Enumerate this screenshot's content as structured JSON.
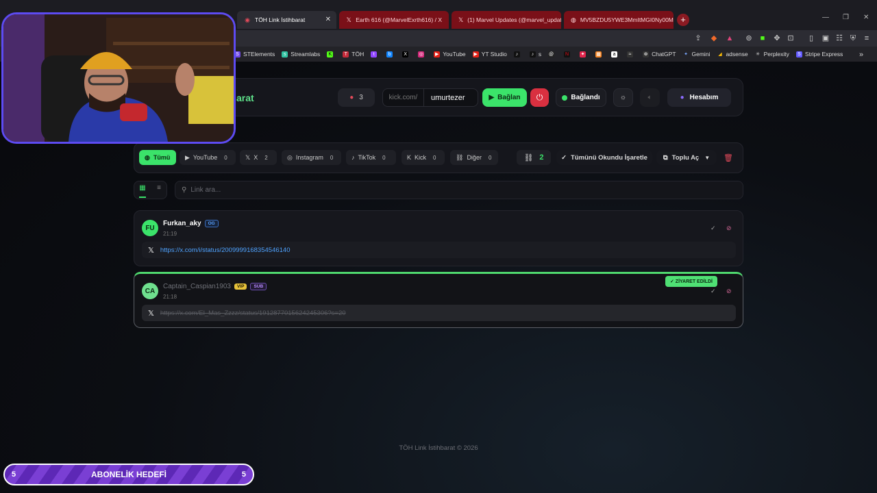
{
  "browser": {
    "tabs": [
      {
        "title": "TÖH Link İstihbarat",
        "active": true
      },
      {
        "title": "Earth 616 (@MarvelExrth616) / X",
        "active": false
      },
      {
        "title": "(1) Marvel Updates (@marvel_updat",
        "active": false
      },
      {
        "title": "MV5BZDU5YWE3MmItMGI0Ny00MY",
        "active": false
      }
    ],
    "bookmarks": [
      "STElements",
      "Streamlabs",
      "TÖH",
      "YouTube",
      "YT Studio",
      "s",
      "ChatGPT",
      "Gemini",
      "adsense",
      "Perplexity",
      "Stripe Express"
    ]
  },
  "app": {
    "brand": "arat",
    "live_count": "3",
    "url_prefix": "kick.com/",
    "channel": "umurtezer",
    "connect_label": "Bağlan",
    "status_label": "Bağlandı",
    "account_label": "Hesabım"
  },
  "filters": [
    {
      "label": "Tümü",
      "count": "",
      "active": true
    },
    {
      "label": "YouTube",
      "count": "0"
    },
    {
      "label": "X",
      "count": "2"
    },
    {
      "label": "Instagram",
      "count": "0"
    },
    {
      "label": "TikTok",
      "count": "0"
    },
    {
      "label": "Kick",
      "count": "0"
    },
    {
      "label": "Diğer",
      "count": "0"
    }
  ],
  "toolbar": {
    "link_total": "2",
    "mark_all": "Tümünü Okundu İşaretle",
    "bulk_open": "Toplu Aç"
  },
  "search": {
    "placeholder": "Link ara..."
  },
  "messages": [
    {
      "initials": "FU",
      "user": "Furkan_aky",
      "badges": [
        "OG"
      ],
      "time": "21:19",
      "url": "https://x.com/i/status/2009999168354546140",
      "visited": false
    },
    {
      "initials": "CA",
      "user": "Captain_Caspian1903",
      "badges": [
        "VIP",
        "SUB"
      ],
      "time": "21:18",
      "url": "https://x.com/El_Mas_Zzzz/status/1912877015624245306?s=20",
      "visited": true
    }
  ],
  "visited_badge": "✓ ZİYARET EDİLDİ",
  "footer": "TÖH Link İstihbarat © 2026",
  "overlay": {
    "goal_title": "ABONELİK HEDEFİ",
    "goal_current": "5",
    "goal_target": "5"
  },
  "colors": {
    "accent": "#3be36a",
    "danger": "#d93040",
    "webcam_border": "#5d4bf2",
    "goal_bg": "#6b34c4"
  }
}
